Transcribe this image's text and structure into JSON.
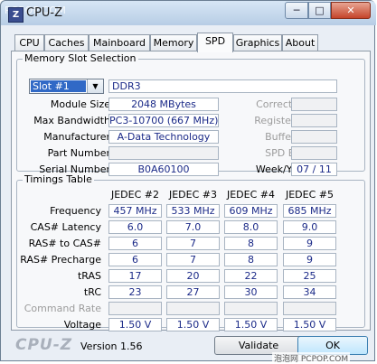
{
  "window": {
    "title": "CPU-Z",
    "watermark": "PCPOP.COM",
    "minimize_glyph": "─",
    "maximize_glyph": "□",
    "close_glyph": "✕"
  },
  "tabs": [
    "CPU",
    "Caches",
    "Mainboard",
    "Memory",
    "SPD",
    "Graphics",
    "About"
  ],
  "active_tab": "SPD",
  "memory_slot": {
    "group_title": "Memory Slot Selection",
    "slot_selected": "Slot #1",
    "dropdown_arrow": "▼",
    "type": "DDR3",
    "labels": {
      "module_size": "Module Size",
      "max_bandwidth": "Max Bandwidth",
      "manufacturer": "Manufacturer",
      "part_number": "Part Number",
      "serial_number": "Serial Number",
      "correction": "Correction",
      "registered": "Registered",
      "buffered": "Buffered",
      "spd_ext": "SPD Ext.",
      "week_year": "Week/Year"
    },
    "values": {
      "module_size": "2048 MBytes",
      "max_bandwidth": "PC3-10700 (667 MHz)",
      "manufacturer": "A-Data Technology",
      "part_number": "",
      "serial_number": "B0A60100",
      "correction": "",
      "registered": "",
      "buffered": "",
      "spd_ext": "",
      "week_year": "07 / 11"
    }
  },
  "timings": {
    "group_title": "Timings Table",
    "columns": [
      "JEDEC #2",
      "JEDEC #3",
      "JEDEC #4",
      "JEDEC #5"
    ],
    "rows": [
      {
        "label": "Frequency",
        "values": [
          "457 MHz",
          "533 MHz",
          "609 MHz",
          "685 MHz"
        ],
        "disabled": false
      },
      {
        "label": "CAS# Latency",
        "values": [
          "6.0",
          "7.0",
          "8.0",
          "9.0"
        ],
        "disabled": false
      },
      {
        "label": "RAS# to CAS#",
        "values": [
          "6",
          "7",
          "8",
          "9"
        ],
        "disabled": false
      },
      {
        "label": "RAS# Precharge",
        "values": [
          "6",
          "7",
          "8",
          "9"
        ],
        "disabled": false
      },
      {
        "label": "tRAS",
        "values": [
          "17",
          "20",
          "22",
          "25"
        ],
        "disabled": false
      },
      {
        "label": "tRC",
        "values": [
          "23",
          "27",
          "30",
          "34"
        ],
        "disabled": false
      },
      {
        "label": "Command Rate",
        "values": [
          "",
          "",
          "",
          ""
        ],
        "disabled": true
      },
      {
        "label": "Voltage",
        "values": [
          "1.50 V",
          "1.50 V",
          "1.50 V",
          "1.50 V"
        ],
        "disabled": false
      }
    ]
  },
  "footer": {
    "logo": "CPU-Z",
    "version": "Version 1.56",
    "validate_label": "Validate",
    "ok_label": "OK",
    "watermark": "泡泡网 PCPOP.COM"
  }
}
